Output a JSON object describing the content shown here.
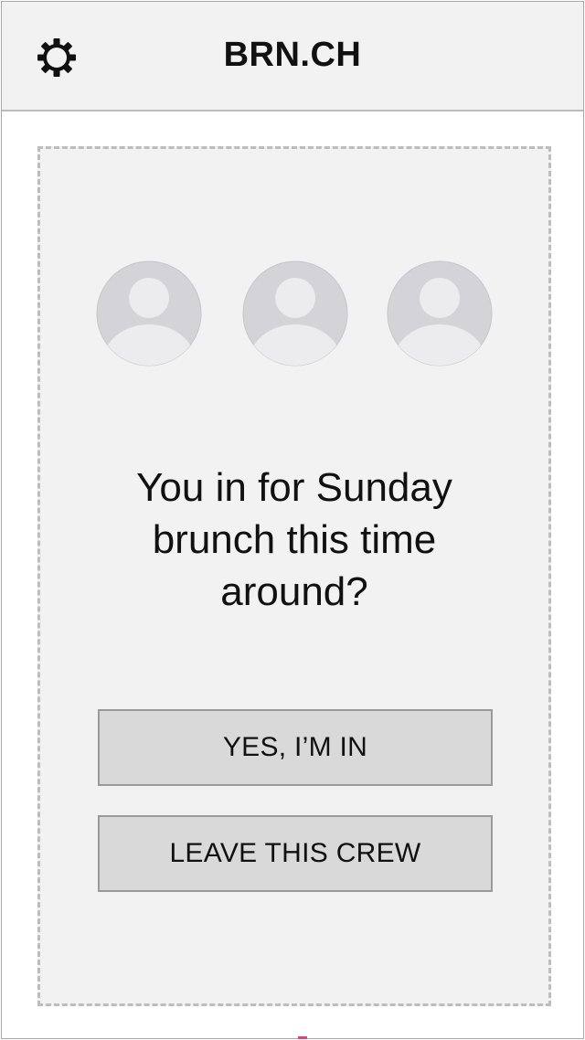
{
  "app": {
    "title": "BRN.CH",
    "settings_icon": "gear-icon"
  },
  "card": {
    "avatars": [
      {
        "icon": "user-avatar-icon"
      },
      {
        "icon": "user-avatar-icon"
      },
      {
        "icon": "user-avatar-icon"
      }
    ],
    "question_lines": [
      "You in for Sunday",
      "brunch this time",
      "around?"
    ]
  },
  "buttons": {
    "yes_label": "YES, I’M IN",
    "leave_label": "LEAVE THIS CREW"
  },
  "colors": {
    "header_bg": "#f2f2f2",
    "card_bg": "#f2f2f2",
    "button_bg": "#d9d9d9",
    "avatar_bg": "#d3d3d8",
    "avatar_body": "#ececee"
  }
}
